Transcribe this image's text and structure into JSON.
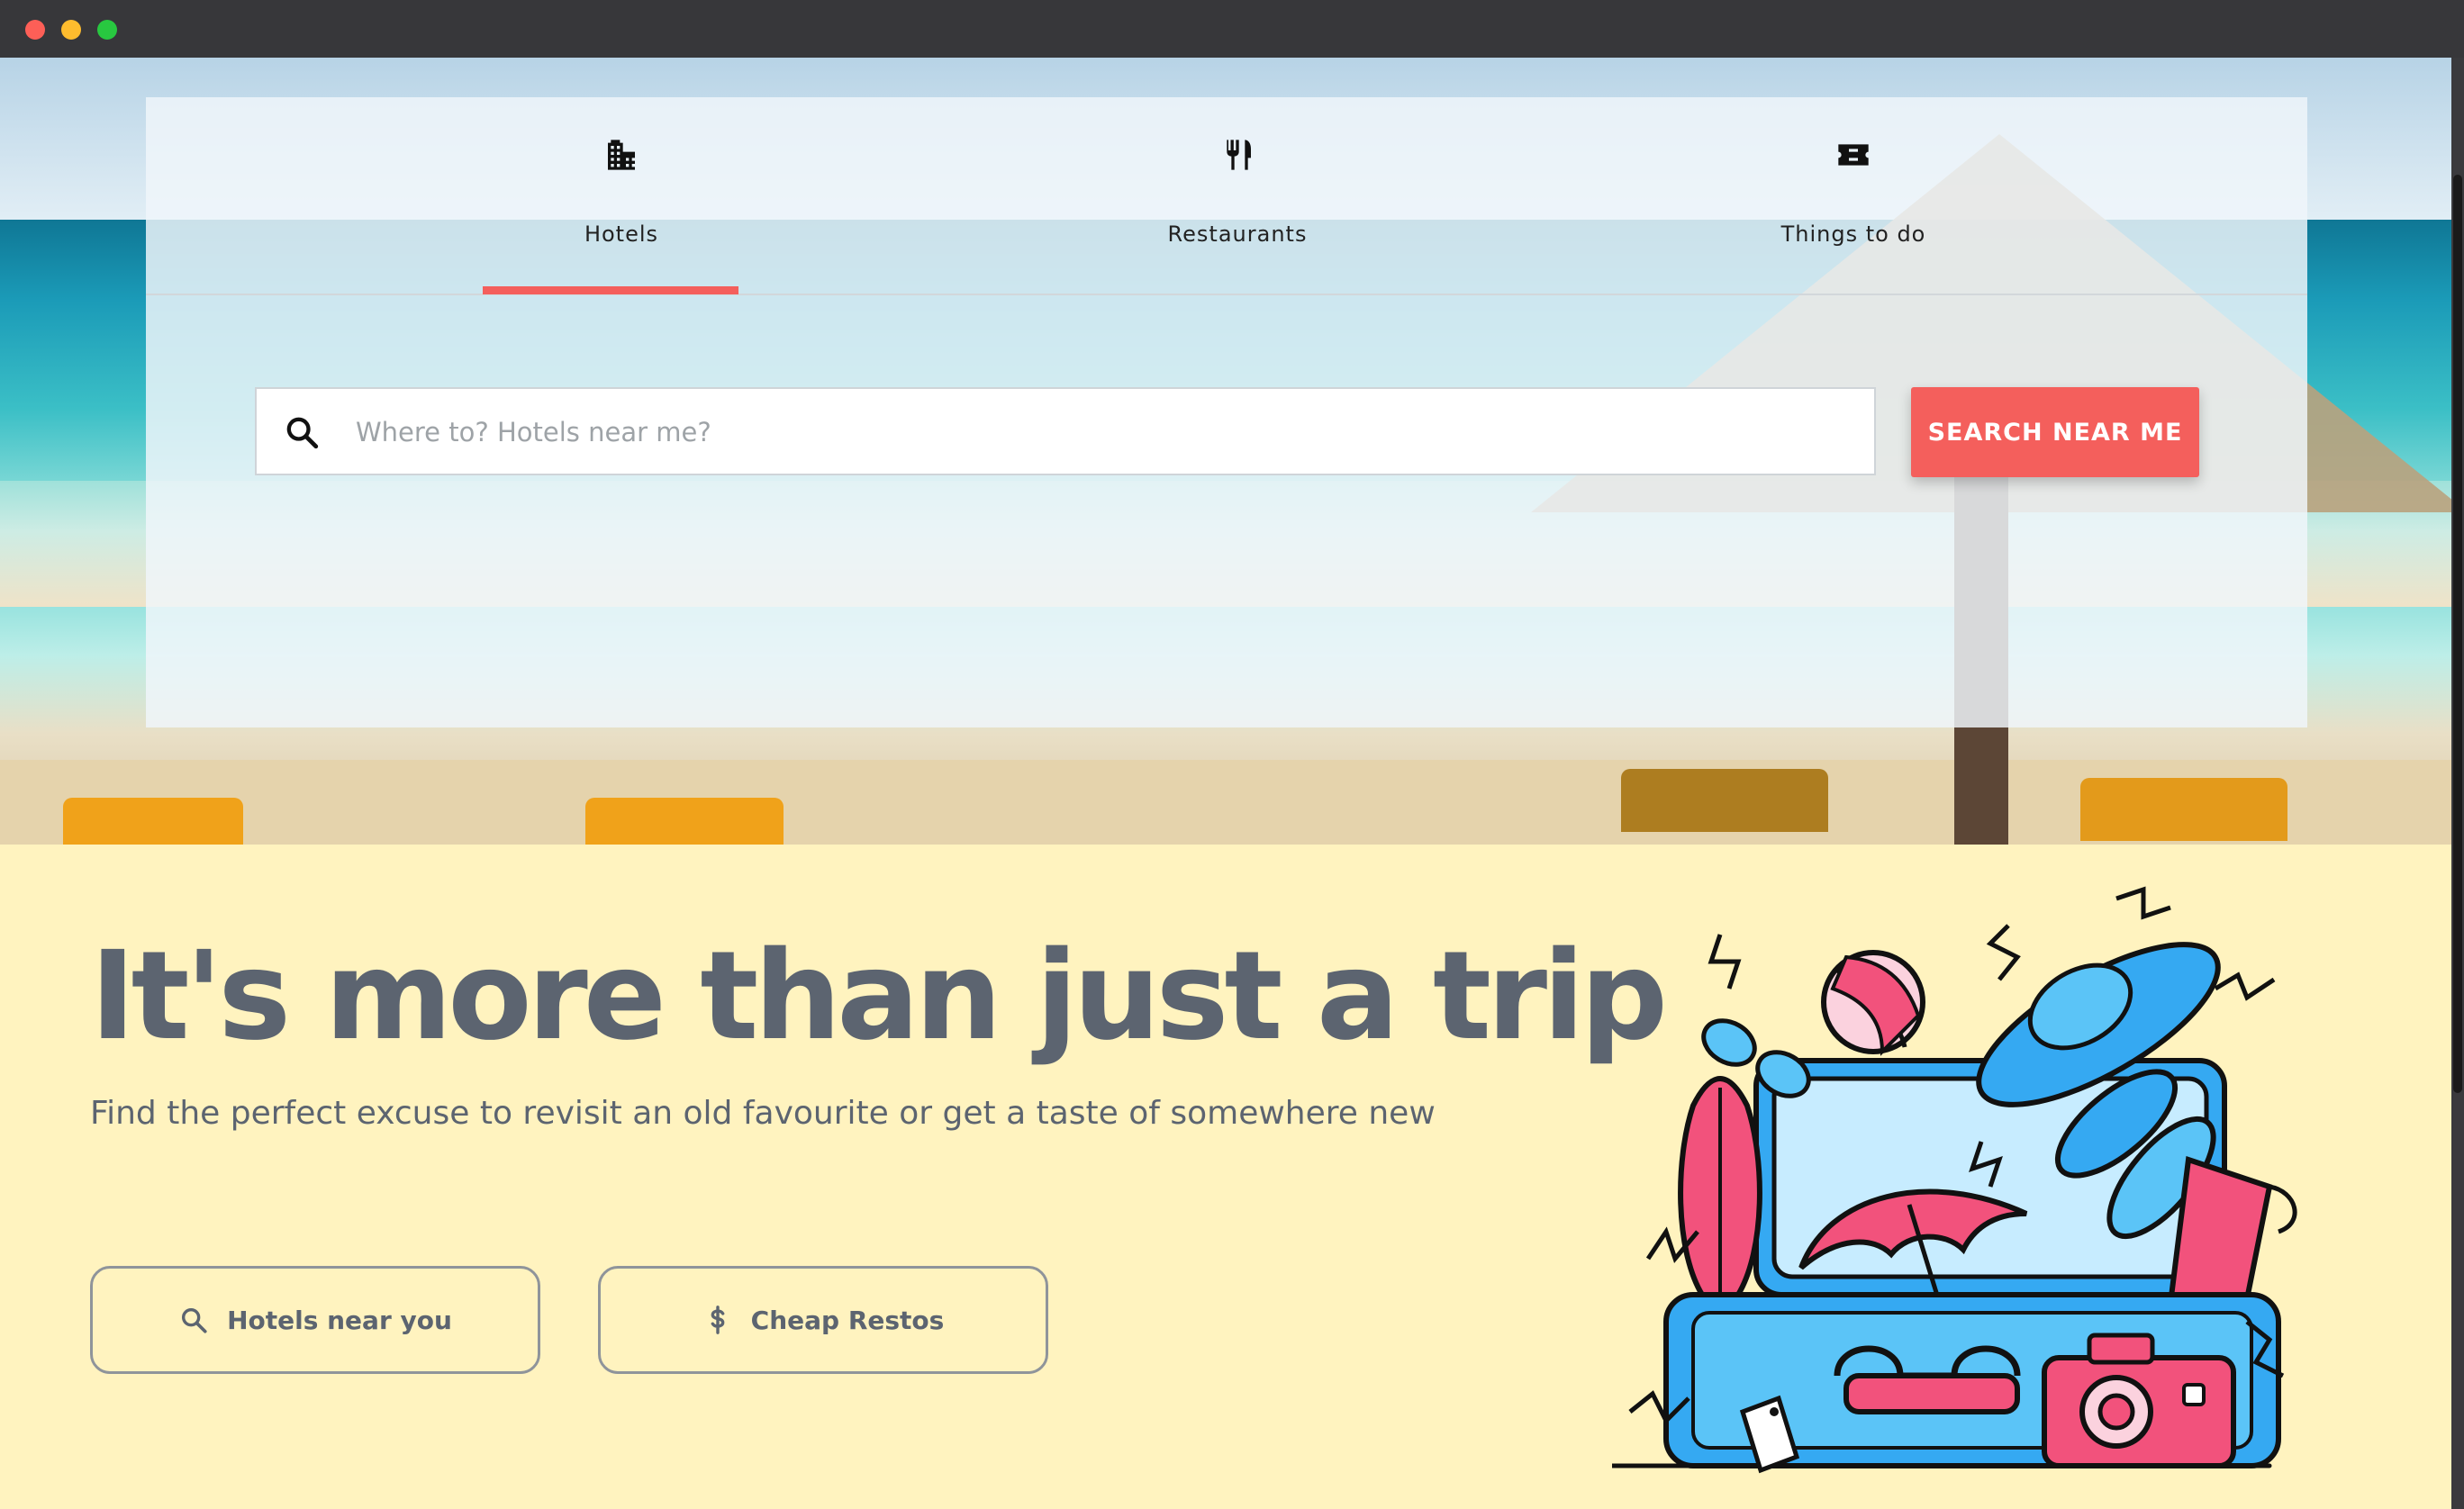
{
  "window": {
    "controls": [
      "close",
      "minimize",
      "maximize"
    ]
  },
  "tabs": [
    {
      "label": "Hotels",
      "icon": "building-icon",
      "active": true
    },
    {
      "label": "Restaurants",
      "icon": "fork-knife-icon",
      "active": false
    },
    {
      "label": "Things to do",
      "icon": "ticket-icon",
      "active": false
    }
  ],
  "search": {
    "value": "",
    "placeholder": "Where to? Hotels near me?",
    "button_label": "SEARCH NEAR ME"
  },
  "promo": {
    "headline": "It's more than just a trip",
    "subline": "Find the perfect excuse to revisit an old favourite or get a taste of somewhere new",
    "buttons": [
      {
        "label": "Hotels near you",
        "icon": "search-icon"
      },
      {
        "label": "Cheap Restos",
        "icon": "dollar-icon"
      }
    ]
  },
  "colors": {
    "accent": "#f45f5c",
    "promo_bg": "#fff3bf",
    "heading_text": "#5c6470"
  }
}
